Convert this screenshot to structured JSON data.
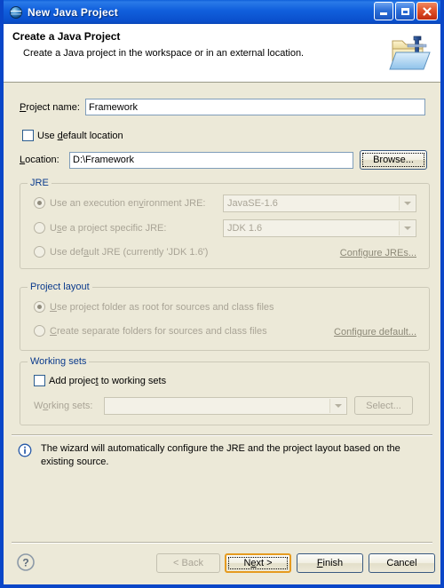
{
  "window": {
    "title": "New Java Project",
    "icon": "java-project-icon",
    "controls": [
      {
        "name": "minimize-button",
        "icon": "minimize-icon"
      },
      {
        "name": "maximize-button",
        "icon": "maximize-icon"
      },
      {
        "name": "close-button",
        "icon": "close-icon"
      }
    ]
  },
  "banner": {
    "title": "Create a Java Project",
    "subtitle": "Create a Java project in the workspace or in an external location.",
    "icon": "java-folder-banner-icon"
  },
  "form": {
    "project_name": {
      "label": "Project name:",
      "mnemonic": "P",
      "value": "Framework",
      "placeholder": ""
    },
    "use_default_location": {
      "label": "Use default location",
      "checked": false
    },
    "location": {
      "label": "Location:",
      "value": "D:\\Framework",
      "placeholder": ""
    },
    "browse_button": "Browse..."
  },
  "jre_group": {
    "title": "JRE",
    "options": [
      {
        "label": "Use an execution environment JRE:",
        "selected": true,
        "disabled": true,
        "combo_value": "JavaSE-1.6"
      },
      {
        "label": "Use a project specific JRE:",
        "selected": false,
        "disabled": true,
        "combo_value": "JDK 1.6"
      },
      {
        "label": "Use default JRE (currently 'JDK 1.6')",
        "selected": false,
        "disabled": true,
        "combo_value": null
      }
    ],
    "configure_link": "Configure JREs..."
  },
  "project_layout_group": {
    "title": "Project layout",
    "options": [
      {
        "label": "Use project folder as root for sources and class files",
        "selected": true,
        "disabled": true
      },
      {
        "label": "Create separate folders for sources and class files",
        "selected": false,
        "disabled": true
      }
    ],
    "configure_link": "Configure default..."
  },
  "working_sets_group": {
    "title": "Working sets",
    "add_checkbox": {
      "label": "Add project to working sets",
      "checked": false
    },
    "working_sets_label": "Working sets:",
    "working_sets_value": "",
    "select_button": "Select..."
  },
  "info": {
    "icon": "information-icon",
    "message": "The wizard will automatically configure the JRE and the project layout based on the existing source."
  },
  "footer": {
    "help_icon": "help-question-icon",
    "buttons": [
      {
        "label": "< Back",
        "name": "back-button",
        "state": "disabled"
      },
      {
        "label": "Next >",
        "name": "next-button",
        "state": "default-focused"
      },
      {
        "label": "Finish",
        "name": "finish-button",
        "state": "enabled"
      },
      {
        "label": "Cancel",
        "name": "cancel-button",
        "state": "enabled"
      }
    ]
  },
  "colors": {
    "dialog_background": "#ECE9D8",
    "titlebar_blue": "#0A4FCC",
    "group_title_blue": "#0A3A8C",
    "focus_orange": "#E59B20",
    "disabled_text": "#A9A496"
  }
}
